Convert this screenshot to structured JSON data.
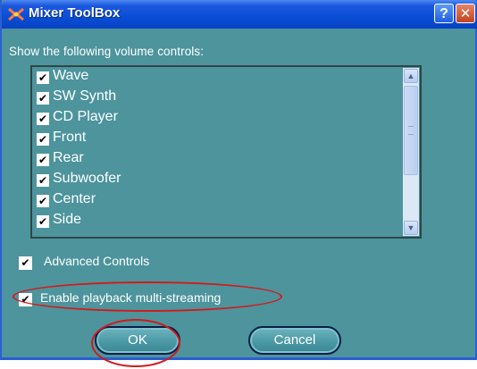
{
  "window": {
    "title": "Mixer ToolBox",
    "help_label": "?",
    "close_label": "✕"
  },
  "prompt": "Show the following volume controls:",
  "volume_controls": [
    {
      "label": "Wave",
      "checked": true
    },
    {
      "label": "SW Synth",
      "checked": true
    },
    {
      "label": "CD Player",
      "checked": true
    },
    {
      "label": "Front",
      "checked": true
    },
    {
      "label": "Rear",
      "checked": true
    },
    {
      "label": "Subwoofer",
      "checked": true
    },
    {
      "label": "Center",
      "checked": true
    },
    {
      "label": "Side",
      "checked": true
    }
  ],
  "options": {
    "advanced_controls": {
      "label": "Advanced Controls",
      "checked": true
    },
    "multistreaming": {
      "label": "Enable playback multi-streaming",
      "checked": true
    }
  },
  "buttons": {
    "ok": "OK",
    "cancel": "Cancel"
  },
  "icons": {
    "app": "mixer-icon",
    "check": "checkmark-icon",
    "scroll_up": "chevron-up-icon",
    "scroll_down": "chevron-down-icon"
  },
  "colors": {
    "window_bg": "#4d949d",
    "title_bar": "#0a4ed6",
    "annotation": "#d21a1a"
  }
}
